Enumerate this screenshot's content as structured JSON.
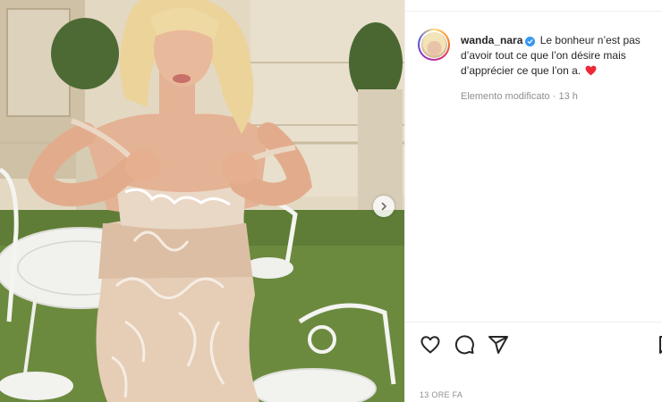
{
  "post": {
    "username": "wanda_nara",
    "caption": "Le bonheur n’est pas d’avoir tout ce que l’on désire mais d’apprécier ce que l’on a.",
    "edited_label": "Elemento modificato",
    "separator": "·",
    "relative_time": "13 h",
    "timestamp": "13 ORE FA"
  },
  "icons": {
    "verified": "verified-badge-icon",
    "emoji": "red-heart-emoji-icon",
    "like": "heart-outline-icon",
    "comment": "comment-icon",
    "share": "paper-plane-icon",
    "save": "bookmark-icon",
    "next": "chevron-right-icon"
  },
  "colors": {
    "verified_blue": "#3897f0",
    "heart_red": "#ed4956",
    "text_primary": "#262626",
    "text_secondary": "#8e8e8e"
  }
}
